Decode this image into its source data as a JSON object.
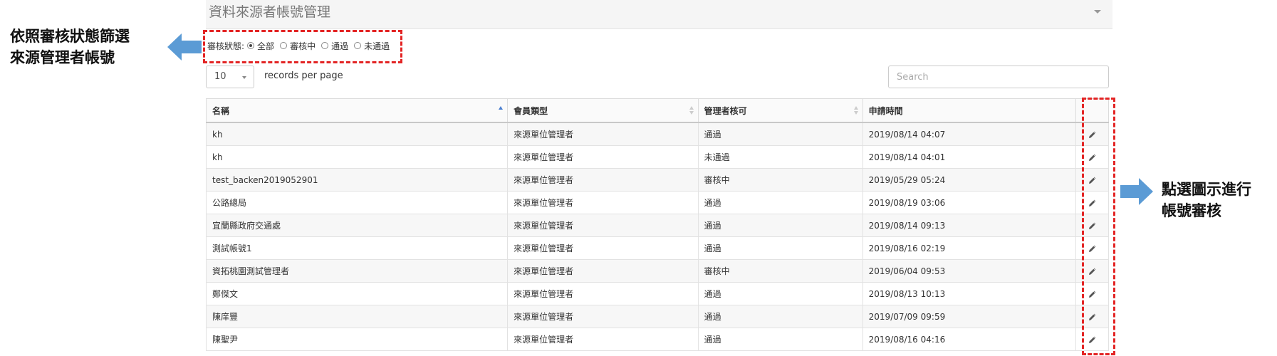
{
  "panel": {
    "title": "資料來源者帳號管理"
  },
  "filter": {
    "label": "審核狀態:",
    "options": [
      {
        "label": "全部",
        "checked": true
      },
      {
        "label": "審核中",
        "checked": false
      },
      {
        "label": "通過",
        "checked": false
      },
      {
        "label": "未通過",
        "checked": false
      }
    ]
  },
  "length": {
    "value": "10",
    "suffix": "records per page"
  },
  "search": {
    "placeholder": "Search"
  },
  "table": {
    "columns": [
      "名稱",
      "會員類型",
      "管理者核可",
      "申請時間"
    ],
    "rows": [
      {
        "name": "kh",
        "type": "來源單位管理者",
        "approval": "通過",
        "time": "2019/08/14 04:07"
      },
      {
        "name": "kh",
        "type": "來源單位管理者",
        "approval": "未通過",
        "time": "2019/08/14 04:01"
      },
      {
        "name": "test_backen2019052901",
        "type": "來源單位管理者",
        "approval": "審核中",
        "time": "2019/05/29 05:24"
      },
      {
        "name": "公路總局",
        "type": "來源單位管理者",
        "approval": "通過",
        "time": "2019/08/19 03:06"
      },
      {
        "name": "宜蘭縣政府交通處",
        "type": "來源單位管理者",
        "approval": "通過",
        "time": "2019/08/14 09:13"
      },
      {
        "name": "測試帳號1",
        "type": "來源單位管理者",
        "approval": "通過",
        "time": "2019/08/16 02:19"
      },
      {
        "name": "資拓桃園測試管理者",
        "type": "來源單位管理者",
        "approval": "審核中",
        "time": "2019/06/04 09:53"
      },
      {
        "name": "鄭傑文",
        "type": "來源單位管理者",
        "approval": "通過",
        "time": "2019/08/13 10:13"
      },
      {
        "name": "陳庠豐",
        "type": "來源單位管理者",
        "approval": "通過",
        "time": "2019/07/09 09:59"
      },
      {
        "name": "陳聖尹",
        "type": "來源單位管理者",
        "approval": "通過",
        "time": "2019/08/16 04:16"
      }
    ]
  },
  "annotations": {
    "left_line1": "依照審核狀態篩選",
    "left_line2": "來源管理者帳號",
    "right_line1": "點選圖示進行",
    "right_line2": "帳號審核"
  },
  "colors": {
    "annotation_red": "#e32424",
    "arrow_blue": "#5b9bd5",
    "pending_red": "#d9534f"
  },
  "icons": {
    "edit": "pencil-icon",
    "arrow": "arrow-icon"
  }
}
